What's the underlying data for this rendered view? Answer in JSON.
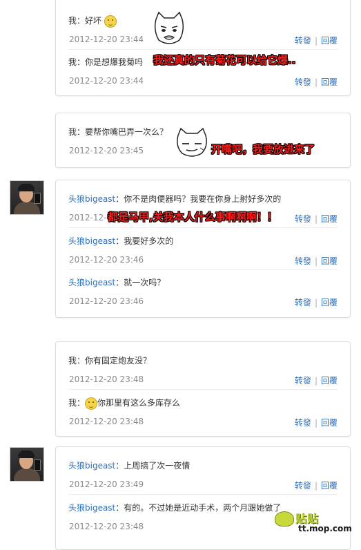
{
  "actions": {
    "forward": "转發",
    "reply": "回覆"
  },
  "cards": [
    {
      "messages": [
        {
          "prefix": "我：",
          "text": "好坏",
          "emoji": "smiley-emoji",
          "time": "2012-12-20 23:44"
        },
        {
          "prefix": "我：",
          "text": "你是想爆我菊吗",
          "time": "2012-12-20 23:44"
        }
      ]
    },
    {
      "messages": [
        {
          "prefix": "我：",
          "text": "要帮你嘴巴弄一次么？",
          "time": "2012-12-20 23:45"
        }
      ]
    },
    {
      "avatar": "user-avatar",
      "messages": [
        {
          "author": "头狼bigeast",
          "text": "：你不是肉便器吗？我要在你身上射好多次的",
          "time": "2012-12-20 23:46"
        },
        {
          "author": "头狼bigeast",
          "text": "：我要好多次的",
          "time": "2012-12-20 23:46"
        },
        {
          "author": "头狼bigeast",
          "text": "：就一次吗？",
          "time": "2012-12-20 23:46"
        }
      ]
    },
    {
      "messages": [
        {
          "prefix": "我：",
          "text": "你有固定炮友没？",
          "time": "2012-12-20 23:48"
        },
        {
          "prefix": "我：",
          "text": "你那里有这么多库存么",
          "emoji": "smiley-emoji",
          "time": "2012-12-20 23:48"
        }
      ]
    },
    {
      "avatar": "user-avatar",
      "messages": [
        {
          "author": "头狼bigeast",
          "text": "：上周搞了次一夜情",
          "time": "2012-12-20 23:49"
        },
        {
          "author": "头狼bigeast",
          "text": "：有的。不过她是近动手术，两个月跟她做了",
          "time": "2012-12-20 23:48"
        }
      ]
    }
  ],
  "overlays": {
    "caption1": "我还真的只有菊花可以给它爆..",
    "caption2": "开嘴吧，我要放进来了",
    "caption3": "都是马甲,关我本人什么事啊啊啊！！"
  },
  "watermark": {
    "cn": "贴贴",
    "url": "tt.mop.com"
  },
  "colors": {
    "link": "#2d6fb8",
    "overlay_text": "#ff1a1a",
    "time": "#8a8a8a"
  }
}
